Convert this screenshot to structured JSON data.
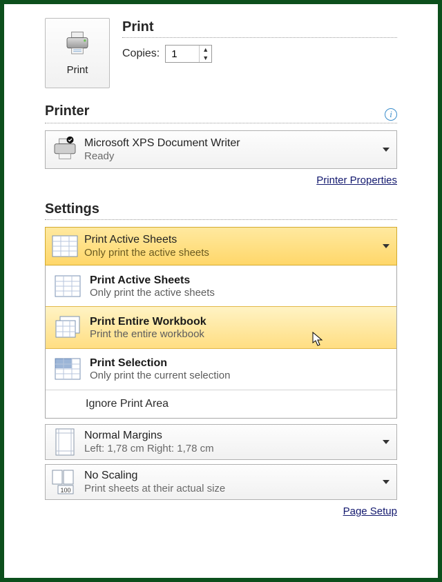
{
  "header": {
    "title": "Print",
    "print_button_label": "Print",
    "copies_label": "Copies:",
    "copies_value": "1"
  },
  "printer": {
    "section_title": "Printer",
    "selected_name": "Microsoft XPS Document Writer",
    "selected_status": "Ready",
    "properties_link": "Printer Properties"
  },
  "settings": {
    "section_title": "Settings",
    "print_what_selected": {
      "title": "Print Active Sheets",
      "subtitle": "Only print the active sheets"
    },
    "print_what_options": [
      {
        "title": "Print Active Sheets",
        "subtitle": "Only print the active sheets"
      },
      {
        "title": "Print Entire Workbook",
        "subtitle": "Print the entire workbook"
      },
      {
        "title": "Print Selection",
        "subtitle": "Only print the current selection"
      }
    ],
    "ignore_print_area": "Ignore Print Area",
    "margins": {
      "title": "Normal Margins",
      "subtitle": "Left: 1,78 cm   Right: 1,78 cm"
    },
    "scaling": {
      "title": "No Scaling",
      "subtitle": "Print sheets at their actual size"
    },
    "page_setup_link": "Page Setup"
  }
}
